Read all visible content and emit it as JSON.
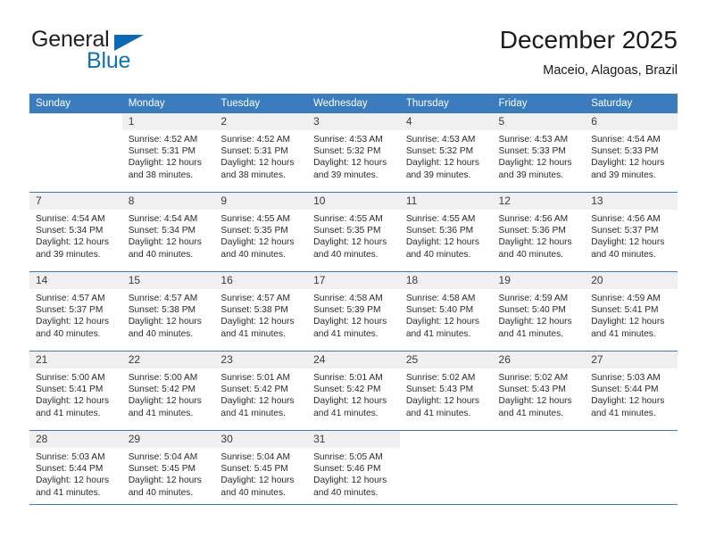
{
  "brand": {
    "name_part1": "General",
    "name_part2": "Blue",
    "triangle_icon": "triangle-icon",
    "colors": {
      "dark": "#231f20",
      "blue": "#1171b8"
    }
  },
  "header": {
    "title": "December 2025",
    "subtitle": "Maceio, Alagoas, Brazil"
  },
  "theme": {
    "header_blue": "#3b7cbe",
    "daynum_bg": "#f0f0f0",
    "text": "#2b2b2b"
  },
  "weekdays": [
    "Sunday",
    "Monday",
    "Tuesday",
    "Wednesday",
    "Thursday",
    "Friday",
    "Saturday"
  ],
  "weeks": [
    [
      {
        "day": "",
        "sunrise": "",
        "sunset": "",
        "daylight": ""
      },
      {
        "day": "1",
        "sunrise": "Sunrise: 4:52 AM",
        "sunset": "Sunset: 5:31 PM",
        "daylight": "Daylight: 12 hours and 38 minutes."
      },
      {
        "day": "2",
        "sunrise": "Sunrise: 4:52 AM",
        "sunset": "Sunset: 5:31 PM",
        "daylight": "Daylight: 12 hours and 38 minutes."
      },
      {
        "day": "3",
        "sunrise": "Sunrise: 4:53 AM",
        "sunset": "Sunset: 5:32 PM",
        "daylight": "Daylight: 12 hours and 39 minutes."
      },
      {
        "day": "4",
        "sunrise": "Sunrise: 4:53 AM",
        "sunset": "Sunset: 5:32 PM",
        "daylight": "Daylight: 12 hours and 39 minutes."
      },
      {
        "day": "5",
        "sunrise": "Sunrise: 4:53 AM",
        "sunset": "Sunset: 5:33 PM",
        "daylight": "Daylight: 12 hours and 39 minutes."
      },
      {
        "day": "6",
        "sunrise": "Sunrise: 4:54 AM",
        "sunset": "Sunset: 5:33 PM",
        "daylight": "Daylight: 12 hours and 39 minutes."
      }
    ],
    [
      {
        "day": "7",
        "sunrise": "Sunrise: 4:54 AM",
        "sunset": "Sunset: 5:34 PM",
        "daylight": "Daylight: 12 hours and 39 minutes."
      },
      {
        "day": "8",
        "sunrise": "Sunrise: 4:54 AM",
        "sunset": "Sunset: 5:34 PM",
        "daylight": "Daylight: 12 hours and 40 minutes."
      },
      {
        "day": "9",
        "sunrise": "Sunrise: 4:55 AM",
        "sunset": "Sunset: 5:35 PM",
        "daylight": "Daylight: 12 hours and 40 minutes."
      },
      {
        "day": "10",
        "sunrise": "Sunrise: 4:55 AM",
        "sunset": "Sunset: 5:35 PM",
        "daylight": "Daylight: 12 hours and 40 minutes."
      },
      {
        "day": "11",
        "sunrise": "Sunrise: 4:55 AM",
        "sunset": "Sunset: 5:36 PM",
        "daylight": "Daylight: 12 hours and 40 minutes."
      },
      {
        "day": "12",
        "sunrise": "Sunrise: 4:56 AM",
        "sunset": "Sunset: 5:36 PM",
        "daylight": "Daylight: 12 hours and 40 minutes."
      },
      {
        "day": "13",
        "sunrise": "Sunrise: 4:56 AM",
        "sunset": "Sunset: 5:37 PM",
        "daylight": "Daylight: 12 hours and 40 minutes."
      }
    ],
    [
      {
        "day": "14",
        "sunrise": "Sunrise: 4:57 AM",
        "sunset": "Sunset: 5:37 PM",
        "daylight": "Daylight: 12 hours and 40 minutes."
      },
      {
        "day": "15",
        "sunrise": "Sunrise: 4:57 AM",
        "sunset": "Sunset: 5:38 PM",
        "daylight": "Daylight: 12 hours and 40 minutes."
      },
      {
        "day": "16",
        "sunrise": "Sunrise: 4:57 AM",
        "sunset": "Sunset: 5:38 PM",
        "daylight": "Daylight: 12 hours and 41 minutes."
      },
      {
        "day": "17",
        "sunrise": "Sunrise: 4:58 AM",
        "sunset": "Sunset: 5:39 PM",
        "daylight": "Daylight: 12 hours and 41 minutes."
      },
      {
        "day": "18",
        "sunrise": "Sunrise: 4:58 AM",
        "sunset": "Sunset: 5:40 PM",
        "daylight": "Daylight: 12 hours and 41 minutes."
      },
      {
        "day": "19",
        "sunrise": "Sunrise: 4:59 AM",
        "sunset": "Sunset: 5:40 PM",
        "daylight": "Daylight: 12 hours and 41 minutes."
      },
      {
        "day": "20",
        "sunrise": "Sunrise: 4:59 AM",
        "sunset": "Sunset: 5:41 PM",
        "daylight": "Daylight: 12 hours and 41 minutes."
      }
    ],
    [
      {
        "day": "21",
        "sunrise": "Sunrise: 5:00 AM",
        "sunset": "Sunset: 5:41 PM",
        "daylight": "Daylight: 12 hours and 41 minutes."
      },
      {
        "day": "22",
        "sunrise": "Sunrise: 5:00 AM",
        "sunset": "Sunset: 5:42 PM",
        "daylight": "Daylight: 12 hours and 41 minutes."
      },
      {
        "day": "23",
        "sunrise": "Sunrise: 5:01 AM",
        "sunset": "Sunset: 5:42 PM",
        "daylight": "Daylight: 12 hours and 41 minutes."
      },
      {
        "day": "24",
        "sunrise": "Sunrise: 5:01 AM",
        "sunset": "Sunset: 5:42 PM",
        "daylight": "Daylight: 12 hours and 41 minutes."
      },
      {
        "day": "25",
        "sunrise": "Sunrise: 5:02 AM",
        "sunset": "Sunset: 5:43 PM",
        "daylight": "Daylight: 12 hours and 41 minutes."
      },
      {
        "day": "26",
        "sunrise": "Sunrise: 5:02 AM",
        "sunset": "Sunset: 5:43 PM",
        "daylight": "Daylight: 12 hours and 41 minutes."
      },
      {
        "day": "27",
        "sunrise": "Sunrise: 5:03 AM",
        "sunset": "Sunset: 5:44 PM",
        "daylight": "Daylight: 12 hours and 41 minutes."
      }
    ],
    [
      {
        "day": "28",
        "sunrise": "Sunrise: 5:03 AM",
        "sunset": "Sunset: 5:44 PM",
        "daylight": "Daylight: 12 hours and 41 minutes."
      },
      {
        "day": "29",
        "sunrise": "Sunrise: 5:04 AM",
        "sunset": "Sunset: 5:45 PM",
        "daylight": "Daylight: 12 hours and 40 minutes."
      },
      {
        "day": "30",
        "sunrise": "Sunrise: 5:04 AM",
        "sunset": "Sunset: 5:45 PM",
        "daylight": "Daylight: 12 hours and 40 minutes."
      },
      {
        "day": "31",
        "sunrise": "Sunrise: 5:05 AM",
        "sunset": "Sunset: 5:46 PM",
        "daylight": "Daylight: 12 hours and 40 minutes."
      },
      {
        "day": "",
        "sunrise": "",
        "sunset": "",
        "daylight": ""
      },
      {
        "day": "",
        "sunrise": "",
        "sunset": "",
        "daylight": ""
      },
      {
        "day": "",
        "sunrise": "",
        "sunset": "",
        "daylight": ""
      }
    ]
  ]
}
